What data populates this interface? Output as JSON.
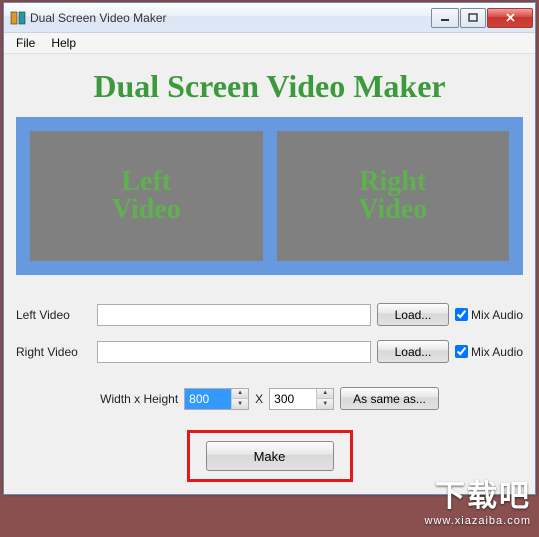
{
  "window": {
    "title": "Dual Screen Video Maker"
  },
  "menu": {
    "file": "File",
    "help": "Help"
  },
  "heading": "Dual Screen Video Maker",
  "preview": {
    "left": "Left\nVideo",
    "right": "Right\nVideo"
  },
  "left": {
    "label": "Left Video",
    "value": "",
    "load": "Load...",
    "mix": "Mix Audio"
  },
  "right": {
    "label": "Right Video",
    "value": "",
    "load": "Load...",
    "mix": "Mix Audio"
  },
  "dims": {
    "label": "Width x Height",
    "width": "800",
    "sep": "X",
    "height": "300",
    "same": "As same as..."
  },
  "make": "Make",
  "watermark": {
    "big": "下载吧",
    "url": "www.xiazaiba.com"
  }
}
